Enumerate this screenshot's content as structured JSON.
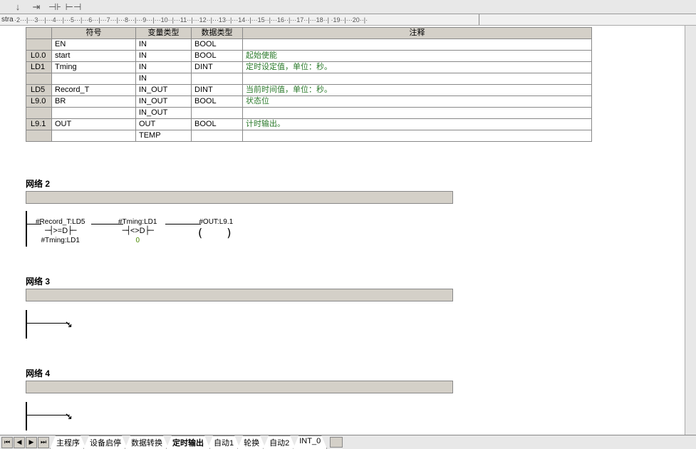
{
  "ruler": {
    "label": "stra",
    "ticks_text": "·2···|···3···|···4···|···5···|···6···|···7···|···8···|···9···|···10··|···11··|···12··|···13··|···14··|···15··|···16··|···17··|···18··|   ·19··|···20··|·"
  },
  "table": {
    "headers": {
      "addr": "",
      "symbol": "符号",
      "vartype": "变量类型",
      "datatype": "数据类型",
      "comment": "注释"
    },
    "rows": [
      {
        "addr": "",
        "symbol": "EN",
        "vartype": "IN",
        "datatype": "BOOL",
        "comment": ""
      },
      {
        "addr": "L0.0",
        "symbol": "start",
        "vartype": "IN",
        "datatype": "BOOL",
        "comment": "起始使能"
      },
      {
        "addr": "LD1",
        "symbol": "Tming",
        "vartype": "IN",
        "datatype": "DINT",
        "comment": "定时设定值，单位：秒。"
      },
      {
        "addr": "",
        "symbol": "",
        "vartype": "IN",
        "datatype": "",
        "comment": ""
      },
      {
        "addr": "LD5",
        "symbol": "Record_T",
        "vartype": "IN_OUT",
        "datatype": "DINT",
        "comment": "当前时间值，单位：秒。"
      },
      {
        "addr": "L9.0",
        "symbol": "BR",
        "vartype": "IN_OUT",
        "datatype": "BOOL",
        "comment": "状态位"
      },
      {
        "addr": "",
        "symbol": "",
        "vartype": "IN_OUT",
        "datatype": "",
        "comment": ""
      },
      {
        "addr": "L9.1",
        "symbol": "OUT",
        "vartype": "OUT",
        "datatype": "BOOL",
        "comment": "计时输出。"
      },
      {
        "addr": "",
        "symbol": "",
        "vartype": "TEMP",
        "datatype": "",
        "comment": ""
      }
    ]
  },
  "networks": {
    "net2": {
      "title": "网络 2",
      "inst1": {
        "top": "#Record_T:LD5",
        "op": ">=D",
        "bottom": "#Tming:LD1"
      },
      "inst2": {
        "top": "#Tming:LD1",
        "op": "<>D",
        "bottom_val": "0"
      },
      "coil": {
        "label": "#OUT:L9.1"
      }
    },
    "net3": {
      "title": "网络 3"
    },
    "net4": {
      "title": "网络 4"
    }
  },
  "tabs": {
    "items": [
      {
        "label": "主程序"
      },
      {
        "label": "设备启停"
      },
      {
        "label": "数据转换"
      },
      {
        "label": "定时输出"
      },
      {
        "label": "自动1"
      },
      {
        "label": "轮换"
      },
      {
        "label": "自动2"
      },
      {
        "label": "INT_0"
      }
    ],
    "active_index": 3
  }
}
